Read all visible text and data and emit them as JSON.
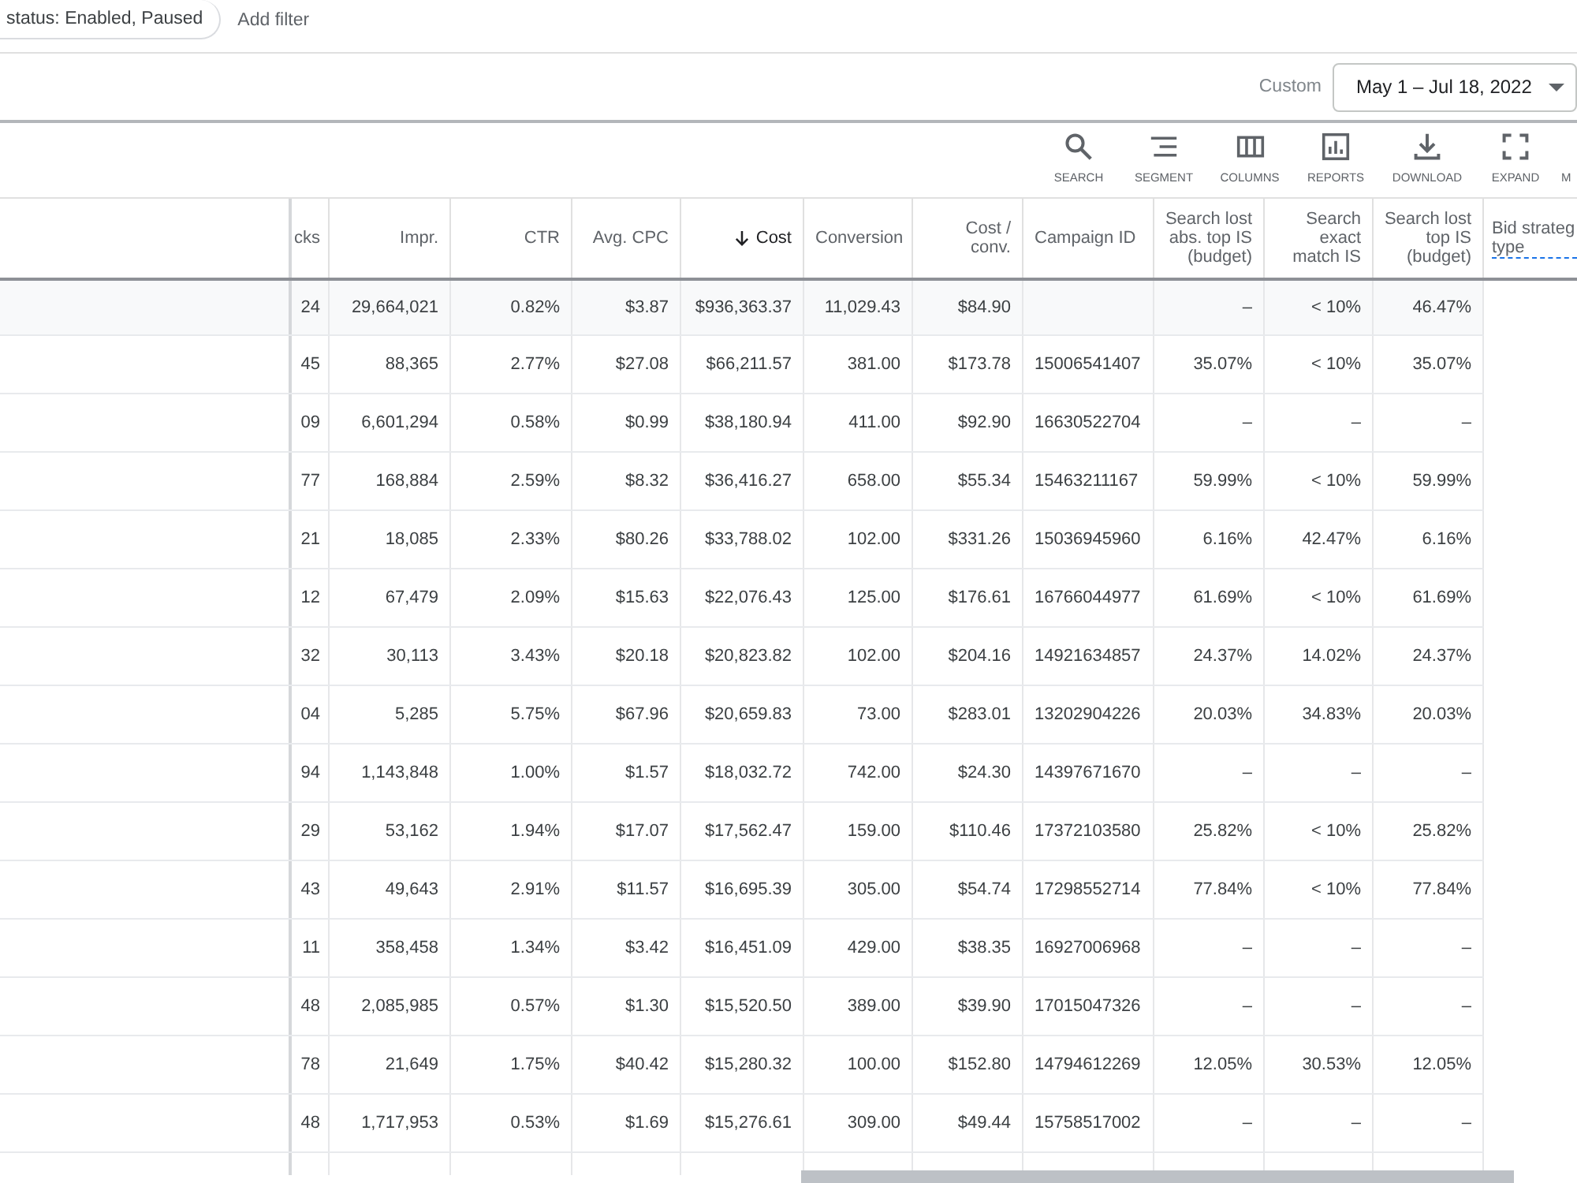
{
  "filter_bar": {
    "filter_chip": "status: Enabled, Paused",
    "add_filter": "Add filter"
  },
  "date_range": {
    "preset": "Custom",
    "range": "May 1 – Jul 18, 2022"
  },
  "toolbar": [
    {
      "label": "SEARCH"
    },
    {
      "label": "SEGMENT"
    },
    {
      "label": "COLUMNS"
    },
    {
      "label": "REPORTS"
    },
    {
      "label": "DOWNLOAD"
    },
    {
      "label": "EXPAND"
    },
    {
      "label": "M"
    }
  ],
  "table": {
    "columns": [
      {
        "label": "cks",
        "sorted": false,
        "has_tooltip": false
      },
      {
        "label": "Impr.",
        "sorted": false,
        "has_tooltip": false
      },
      {
        "label": "CTR",
        "sorted": false,
        "has_tooltip": false
      },
      {
        "label": "Avg. CPC",
        "sorted": false,
        "has_tooltip": false
      },
      {
        "label": "Cost",
        "sorted": true,
        "has_tooltip": false
      },
      {
        "label": "Conversion",
        "sorted": false,
        "has_tooltip": false
      },
      {
        "label": "Cost / conv.",
        "sorted": false,
        "has_tooltip": false
      },
      {
        "label": "Campaign ID",
        "sorted": false,
        "has_tooltip": false
      },
      {
        "label": "Search lost abs. top IS (budget)",
        "sorted": false,
        "has_tooltip": false
      },
      {
        "label": "Search exact match IS",
        "sorted": false,
        "has_tooltip": false
      },
      {
        "label": "Search lost top IS (budget)",
        "sorted": false,
        "has_tooltip": false
      },
      {
        "label": "Bid strateg type",
        "sorted": false,
        "has_tooltip": true
      }
    ],
    "rows": [
      {
        "kind": "total",
        "column_1": "24",
        "impr": "29,664,021",
        "ctr": "0.82%",
        "avg_cpc": "$3.87",
        "cost": "$936,363.37",
        "column_6": "11,029.43",
        "cost_per_conv": "$84.90",
        "search_lost_abs_top_is_budget": "–",
        "search_exact_match_is": "< 10%",
        "search_lost_top_is_budget": "46.47%"
      },
      {
        "kind": "campaign",
        "column_1": "45",
        "impr": "88,365",
        "ctr": "2.77%",
        "avg_cpc": "$27.08",
        "cost": "$66,211.57",
        "column_6": "381.00",
        "cost_per_conv": "$173.78",
        "campaign_id": "15006541407",
        "search_lost_abs_top_is_budget": "35.07%",
        "search_exact_match_is": "< 10%",
        "search_lost_top_is_budget": "35.07%"
      },
      {
        "kind": "campaign",
        "column_1": "09",
        "impr": "6,601,294",
        "ctr": "0.58%",
        "avg_cpc": "$0.99",
        "cost": "$38,180.94",
        "column_6": "411.00",
        "cost_per_conv": "$92.90",
        "campaign_id": "16630522704",
        "search_lost_abs_top_is_budget": "–",
        "search_exact_match_is": "–",
        "search_lost_top_is_budget": "–"
      },
      {
        "kind": "campaign",
        "column_1": "77",
        "impr": "168,884",
        "ctr": "2.59%",
        "avg_cpc": "$8.32",
        "cost": "$36,416.27",
        "column_6": "658.00",
        "cost_per_conv": "$55.34",
        "campaign_id": "15463211167",
        "search_lost_abs_top_is_budget": "59.99%",
        "search_exact_match_is": "< 10%",
        "search_lost_top_is_budget": "59.99%"
      },
      {
        "kind": "campaign",
        "column_1": "21",
        "impr": "18,085",
        "ctr": "2.33%",
        "avg_cpc": "$80.26",
        "cost": "$33,788.02",
        "column_6": "102.00",
        "cost_per_conv": "$331.26",
        "campaign_id": "15036945960",
        "search_lost_abs_top_is_budget": "6.16%",
        "search_exact_match_is": "42.47%",
        "search_lost_top_is_budget": "6.16%"
      },
      {
        "kind": "campaign",
        "column_1": "12",
        "impr": "67,479",
        "ctr": "2.09%",
        "avg_cpc": "$15.63",
        "cost": "$22,076.43",
        "column_6": "125.00",
        "cost_per_conv": "$176.61",
        "campaign_id": "16766044977",
        "search_lost_abs_top_is_budget": "61.69%",
        "search_exact_match_is": "< 10%",
        "search_lost_top_is_budget": "61.69%"
      },
      {
        "kind": "campaign",
        "column_1": "32",
        "impr": "30,113",
        "ctr": "3.43%",
        "avg_cpc": "$20.18",
        "cost": "$20,823.82",
        "column_6": "102.00",
        "cost_per_conv": "$204.16",
        "campaign_id": "14921634857",
        "search_lost_abs_top_is_budget": "24.37%",
        "search_exact_match_is": "14.02%",
        "search_lost_top_is_budget": "24.37%"
      },
      {
        "kind": "campaign",
        "column_1": "04",
        "impr": "5,285",
        "ctr": "5.75%",
        "avg_cpc": "$67.96",
        "cost": "$20,659.83",
        "column_6": "73.00",
        "cost_per_conv": "$283.01",
        "campaign_id": "13202904226",
        "search_lost_abs_top_is_budget": "20.03%",
        "search_exact_match_is": "34.83%",
        "search_lost_top_is_budget": "20.03%"
      },
      {
        "kind": "campaign",
        "column_1": "94",
        "impr": "1,143,848",
        "ctr": "1.00%",
        "avg_cpc": "$1.57",
        "cost": "$18,032.72",
        "column_6": "742.00",
        "cost_per_conv": "$24.30",
        "campaign_id": "14397671670",
        "search_lost_abs_top_is_budget": "–",
        "search_exact_match_is": "–",
        "search_lost_top_is_budget": "–"
      },
      {
        "kind": "campaign",
        "column_1": "29",
        "impr": "53,162",
        "ctr": "1.94%",
        "avg_cpc": "$17.07",
        "cost": "$17,562.47",
        "column_6": "159.00",
        "cost_per_conv": "$110.46",
        "campaign_id": "17372103580",
        "search_lost_abs_top_is_budget": "25.82%",
        "search_exact_match_is": "< 10%",
        "search_lost_top_is_budget": "25.82%"
      },
      {
        "kind": "campaign",
        "column_1": "43",
        "impr": "49,643",
        "ctr": "2.91%",
        "avg_cpc": "$11.57",
        "cost": "$16,695.39",
        "column_6": "305.00",
        "cost_per_conv": "$54.74",
        "campaign_id": "17298552714",
        "search_lost_abs_top_is_budget": "77.84%",
        "search_exact_match_is": "< 10%",
        "search_lost_top_is_budget": "77.84%"
      },
      {
        "kind": "campaign",
        "column_1": "11",
        "impr": "358,458",
        "ctr": "1.34%",
        "avg_cpc": "$3.42",
        "cost": "$16,451.09",
        "column_6": "429.00",
        "cost_per_conv": "$38.35",
        "campaign_id": "16927006968",
        "search_lost_abs_top_is_budget": "–",
        "search_exact_match_is": "–",
        "search_lost_top_is_budget": "–"
      },
      {
        "kind": "campaign",
        "column_1": "48",
        "impr": "2,085,985",
        "ctr": "0.57%",
        "avg_cpc": "$1.30",
        "cost": "$15,520.50",
        "column_6": "389.00",
        "cost_per_conv": "$39.90",
        "campaign_id": "17015047326",
        "search_lost_abs_top_is_budget": "–",
        "search_exact_match_is": "–",
        "search_lost_top_is_budget": "–"
      },
      {
        "kind": "campaign",
        "column_1": "78",
        "impr": "21,649",
        "ctr": "1.75%",
        "avg_cpc": "$40.42",
        "cost": "$15,280.32",
        "column_6": "100.00",
        "cost_per_conv": "$152.80",
        "campaign_id": "14794612269",
        "search_lost_abs_top_is_budget": "12.05%",
        "search_exact_match_is": "30.53%",
        "search_lost_top_is_budget": "12.05%"
      },
      {
        "kind": "campaign",
        "column_1": "48",
        "impr": "1,717,953",
        "ctr": "0.53%",
        "avg_cpc": "$1.69",
        "cost": "$15,276.61",
        "column_6": "309.00",
        "cost_per_conv": "$49.44",
        "campaign_id": "15758517002",
        "search_lost_abs_top_is_budget": "–",
        "search_exact_match_is": "–",
        "search_lost_top_is_budget": "–"
      }
    ]
  }
}
